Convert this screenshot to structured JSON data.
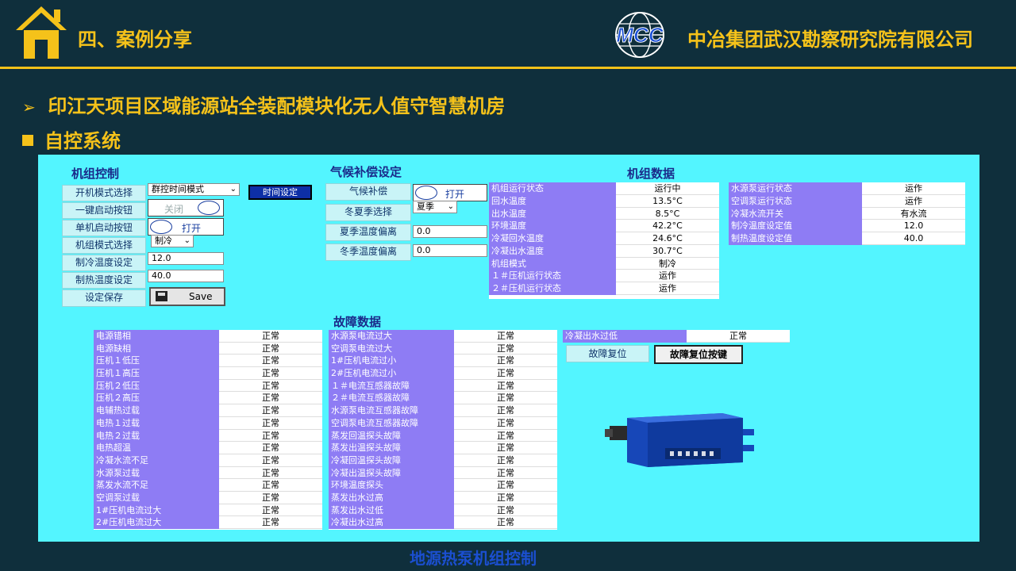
{
  "header": {
    "section_title": "四、案例分享",
    "company": "中冶集团武汉勘察研究院有限公司",
    "logo_text": "MCC"
  },
  "bullets": {
    "project": "印江天项目区域能源站全装配模块化无人值守智慧机房",
    "subsection": "自控系统"
  },
  "control": {
    "title": "机组控制",
    "labels": [
      "开机模式选择",
      "一键启动按钮",
      "单机启动按钮",
      "机组模式选择",
      "制冷温度设定",
      "制热温度设定",
      "设定保存"
    ],
    "mode_select": "群控时间模式",
    "time_setting_button": "时间设定",
    "one_key_toggle": "关闭",
    "single_toggle": "打开",
    "unit_mode_select": "制冷",
    "cool_temp": "12.0",
    "heat_temp": "40.0",
    "save_label": "Save"
  },
  "climate": {
    "title": "气候补偿设定",
    "labels": [
      "气候补偿",
      "冬夏季选择",
      "夏季温度偏离",
      "冬季温度偏离"
    ],
    "comp_toggle": "打开",
    "season_select": "夏季",
    "summer_offset": "0.0",
    "winter_offset": "0.0"
  },
  "unit_data": {
    "title": "机组数据",
    "rows": [
      {
        "k": "机组运行状态",
        "v": "运行中"
      },
      {
        "k": "回水温度",
        "v": "13.5°C"
      },
      {
        "k": "出水温度",
        "v": "8.5°C"
      },
      {
        "k": "环境温度",
        "v": "42.2°C"
      },
      {
        "k": "冷凝回水温度",
        "v": "24.6°C"
      },
      {
        "k": "冷凝出水温度",
        "v": "30.7°C"
      },
      {
        "k": "机组模式",
        "v": "制冷"
      },
      {
        "k": "１＃压机运行状态",
        "v": "运作"
      },
      {
        "k": "２＃压机运行状态",
        "v": "运作"
      }
    ],
    "rows2": [
      {
        "k": "水源泵运行状态",
        "v": "运作"
      },
      {
        "k": "空调泵运行状态",
        "v": "运作"
      },
      {
        "k": "冷凝水流开关",
        "v": "有水流"
      },
      {
        "k": "制冷温度设定值",
        "v": "12.0"
      },
      {
        "k": "制热温度设定值",
        "v": "40.0"
      }
    ]
  },
  "fault": {
    "title": "故障数据",
    "col1": [
      {
        "k": "电源错相",
        "v": "正常"
      },
      {
        "k": "电源缺相",
        "v": "正常"
      },
      {
        "k": "压机１低压",
        "v": "正常"
      },
      {
        "k": "压机１高压",
        "v": "正常"
      },
      {
        "k": "压机２低压",
        "v": "正常"
      },
      {
        "k": "压机２高压",
        "v": "正常"
      },
      {
        "k": "电辅热过载",
        "v": "正常"
      },
      {
        "k": "电热１过载",
        "v": "正常"
      },
      {
        "k": "电热２过载",
        "v": "正常"
      },
      {
        "k": "电热超温",
        "v": "正常"
      },
      {
        "k": "冷凝水流不足",
        "v": "正常"
      },
      {
        "k": "水源泵过载",
        "v": "正常"
      },
      {
        "k": "蒸发水流不足",
        "v": "正常"
      },
      {
        "k": "空调泵过载",
        "v": "正常"
      },
      {
        "k": "1#压机电流过大",
        "v": "正常"
      },
      {
        "k": "2#压机电流过大",
        "v": "正常"
      }
    ],
    "col2": [
      {
        "k": "水源泵电流过大",
        "v": "正常"
      },
      {
        "k": "空调泵电流过大",
        "v": "正常"
      },
      {
        "k": "1#压机电流过小",
        "v": "正常"
      },
      {
        "k": "2#压机电流过小",
        "v": "正常"
      },
      {
        "k": "１＃电流互感器故障",
        "v": "正常"
      },
      {
        "k": "２＃电流互感器故障",
        "v": "正常"
      },
      {
        "k": "水源泵电流互感器故障",
        "v": "正常"
      },
      {
        "k": "空调泵电流互感器故障",
        "v": "正常"
      },
      {
        "k": "蒸发回温探头故障",
        "v": "正常"
      },
      {
        "k": "蒸发出温探头故障",
        "v": "正常"
      },
      {
        "k": "冷凝回温探头故障",
        "v": "正常"
      },
      {
        "k": "冷凝出温探头故障",
        "v": "正常"
      },
      {
        "k": "环境温度探头",
        "v": "正常"
      },
      {
        "k": "蒸发出水过高",
        "v": "正常"
      },
      {
        "k": "蒸发出水过低",
        "v": "正常"
      },
      {
        "k": "冷凝出水过高",
        "v": "正常"
      }
    ],
    "col3": [
      {
        "k": "冷凝出水过低",
        "v": "正常"
      }
    ],
    "reset_label": "故障复位",
    "reset_button": "故障复位按键"
  },
  "caption": "地源热泵机组控制",
  "colors": {
    "background": "#0f2f3c",
    "accent": "#f5c21a",
    "panel": "#53f5ff",
    "table_key": "#8e7cf4"
  }
}
